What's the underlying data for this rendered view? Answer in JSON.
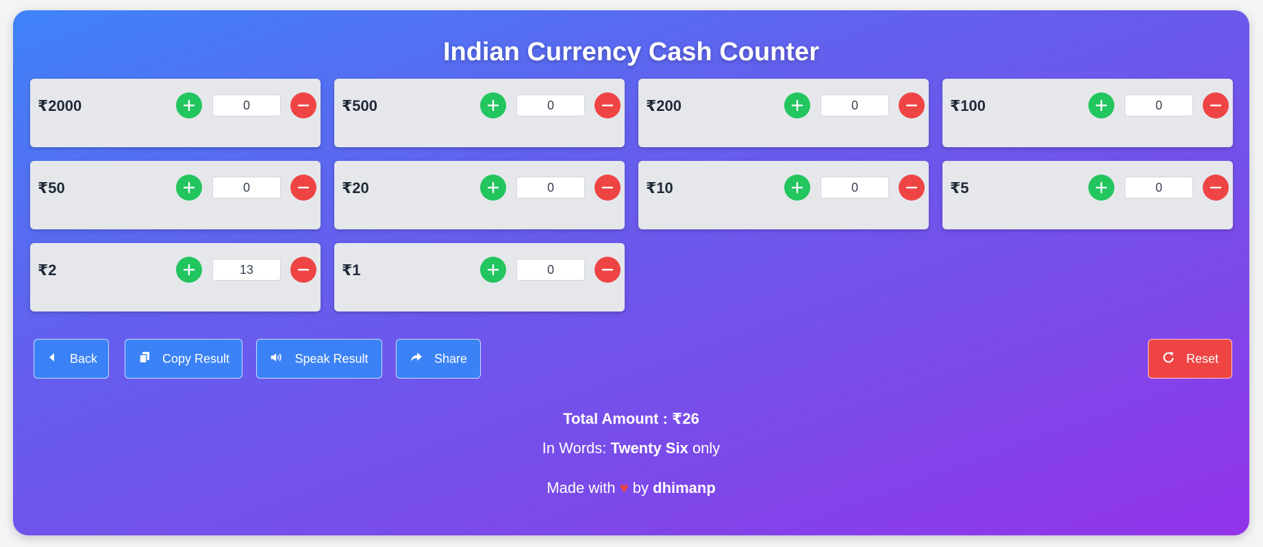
{
  "title": "Indian Currency Cash Counter",
  "denominations": [
    {
      "label": "₹2000",
      "count": "0"
    },
    {
      "label": "₹500",
      "count": "0"
    },
    {
      "label": "₹200",
      "count": "0"
    },
    {
      "label": "₹100",
      "count": "0"
    },
    {
      "label": "₹50",
      "count": "0"
    },
    {
      "label": "₹20",
      "count": "0"
    },
    {
      "label": "₹10",
      "count": "0"
    },
    {
      "label": "₹5",
      "count": "0"
    },
    {
      "label": "₹2",
      "count": "13"
    },
    {
      "label": "₹1",
      "count": "0"
    }
  ],
  "actions": {
    "back": "Back",
    "copy": "Copy Result",
    "speak": "Speak Result",
    "share": "Share",
    "reset": "Reset"
  },
  "summary": {
    "total": "Total Amount : ₹26",
    "words_prefix": "In Words: ",
    "words_value": "Twenty Six",
    "words_suffix": " only"
  },
  "footer": {
    "made_with": "Made with ",
    "heart": "♥",
    "by": " by ",
    "author": "dhimanp"
  },
  "colors": {
    "plus": "#22c55e",
    "minus": "#ef4444",
    "action": "#3b82f6",
    "reset": "#ef4444"
  }
}
